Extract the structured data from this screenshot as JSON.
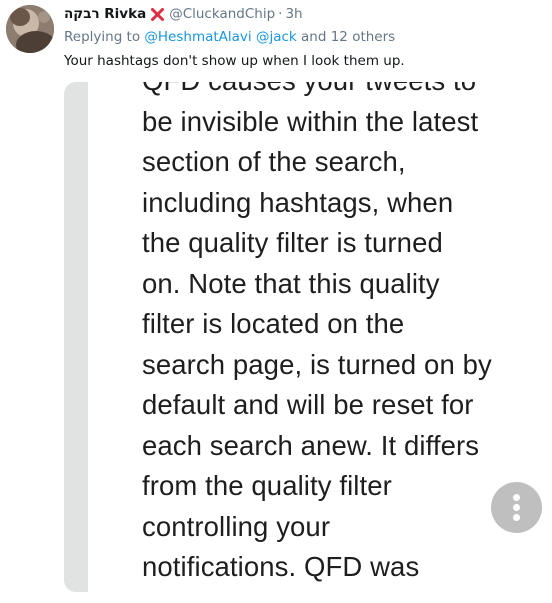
{
  "tweet": {
    "display_name": "רבקה Rivka",
    "name_emoji": "cross-mark-icon",
    "handle": "@CluckandChip",
    "separator": "·",
    "time": "3h",
    "reply": {
      "prefix": "Replying to",
      "mention_1": "@HeshmatAlavi",
      "mention_2": "@jack",
      "suffix": "and 12 others"
    },
    "text": "Your hashtags don't show up when I look them up."
  },
  "media": {
    "lines": [
      "QFD causes your tweets to",
      "be invisible within the latest",
      "section of the search,",
      "including hashtags, when",
      "the quality filter is turned",
      "on. Note that this quality",
      "filter is located on the",
      "search page, is turned on by",
      "default and will be reset for",
      "each search anew. It differs",
      "from the quality filter",
      "controlling your",
      "notifications. QFD was"
    ],
    "more_button_icon": "more-vertical-icon"
  },
  "colors": {
    "text": "#14171a",
    "secondary": "#657786",
    "link": "#1b95e0",
    "emoji_red": "#dd2e44"
  }
}
